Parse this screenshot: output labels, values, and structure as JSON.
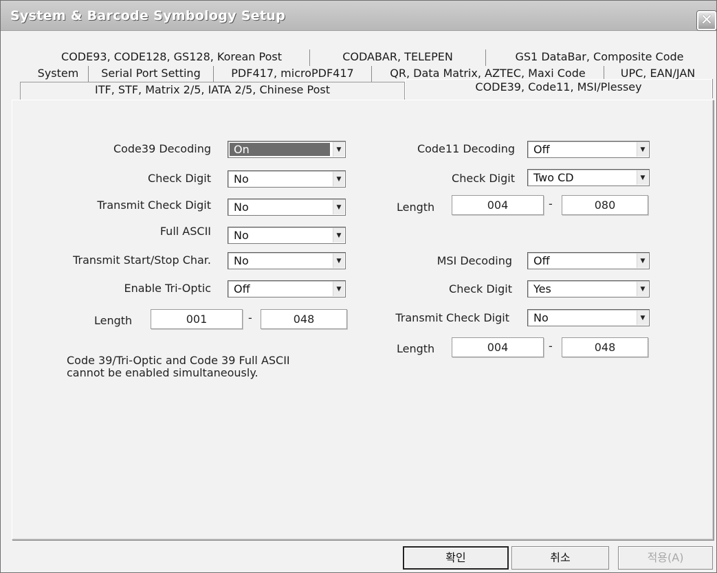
{
  "window": {
    "title": "System & Barcode Symbology Setup",
    "close_label": "✕"
  },
  "tabs": {
    "row1": [
      "CODE93, CODE128, GS128, Korean Post",
      "CODABAR, TELEPEN",
      "GS1 DataBar, Composite Code"
    ],
    "row2": [
      "System",
      "Serial Port Setting",
      "PDF417, microPDF417",
      "QR, Data Matrix, AZTEC, Maxi Code",
      "UPC, EAN/JAN"
    ],
    "row3": [
      "ITF, STF, Matrix 2/5, IATA 2/5, Chinese Post",
      "CODE39, Code11, MSI/Plessey"
    ],
    "active": "CODE39, Code11, MSI/Plessey"
  },
  "code39": {
    "decoding": {
      "label": "Code39 Decoding",
      "value": "On"
    },
    "check_digit": {
      "label": "Check Digit",
      "value": "No"
    },
    "transmit_check_digit": {
      "label": "Transmit Check Digit",
      "value": "No"
    },
    "full_ascii": {
      "label": "Full ASCII",
      "value": "No"
    },
    "transmit_start_stop": {
      "label": "Transmit Start/Stop Char.",
      "value": "No"
    },
    "tri_optic": {
      "label": "Enable Tri-Optic",
      "value": "Off"
    },
    "length": {
      "label": "Length",
      "min": "001",
      "max": "048"
    },
    "note": "Code 39/Tri-Optic and Code 39 Full ASCII cannot be enabled simultaneously."
  },
  "code11": {
    "decoding": {
      "label": "Code11 Decoding",
      "value": "Off"
    },
    "check_digit": {
      "label": "Check Digit",
      "value": "Two CD"
    },
    "length": {
      "label": "Length",
      "min": "004",
      "max": "080"
    }
  },
  "msi": {
    "decoding": {
      "label": "MSI Decoding",
      "value": "Off"
    },
    "check_digit": {
      "label": "Check Digit",
      "value": "Yes"
    },
    "transmit_check_digit": {
      "label": "Transmit Check Digit",
      "value": "No"
    },
    "length": {
      "label": "Length",
      "min": "004",
      "max": "048"
    }
  },
  "buttons": {
    "ok": "확인",
    "cancel": "취소",
    "apply": "적용(A)"
  },
  "range_separator": "-"
}
